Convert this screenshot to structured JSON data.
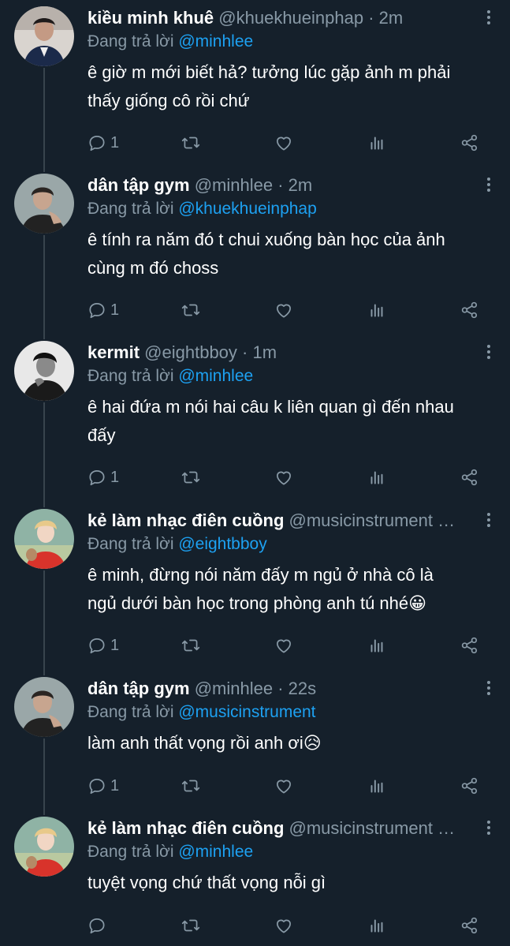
{
  "colors": {
    "background": "#15202b",
    "text": "#ffffff",
    "muted": "#8899a6",
    "link": "#1da1f2",
    "thread": "#38444d"
  },
  "replies_prefix": "Đang trả lời",
  "tweets": [
    {
      "name": "kiều minh khuê",
      "handle": "@khuekhueinphap",
      "sep": "·",
      "time": "2m",
      "reply_to": "@minhlee",
      "text": [
        "ê giờ m mới biết hả? tưởng lúc gặp ảnh m phải",
        "thấy giống cô rồi chứ"
      ],
      "reply_count": "1",
      "icons": [
        "comment-icon",
        "retweet-icon",
        "like-icon",
        "stats-icon",
        "share-icon"
      ]
    },
    {
      "name": "dân tập gym",
      "handle": "@minhlee",
      "sep": "·",
      "time": "2m",
      "reply_to": "@khuekhueinphap",
      "text": [
        "ê tính ra năm đó t chui xuống bàn học của ảnh",
        "cùng m đó choss"
      ],
      "reply_count": "1"
    },
    {
      "name": "kermit",
      "handle": "@eightbboy",
      "sep": "·",
      "time": "1m",
      "reply_to": "@minhlee",
      "text": [
        "ê hai đứa m nói hai câu k liên quan gì đến nhau",
        "đấy"
      ],
      "reply_count": "1"
    },
    {
      "name": "kẻ làm nhạc điên cuồng",
      "handle": "@musicinstrument …",
      "sep": "",
      "time": "",
      "reply_to": "@eightbboy",
      "text": [
        "ê minh, đừng nói năm đấy m ngủ ở nhà cô là",
        "ngủ dưới bàn học trong phòng anh tú nhé😀"
      ],
      "reply_count": "1"
    },
    {
      "name": "dân tập gym",
      "handle": "@minhlee",
      "sep": "·",
      "time": "22s",
      "reply_to": "@musicinstrument",
      "text": [
        "làm anh thất vọng rồi anh ơi😥"
      ],
      "reply_count": "1"
    },
    {
      "name": "kẻ làm nhạc điên cuồng",
      "handle": "@musicinstrument …",
      "sep": "",
      "time": "",
      "reply_to": "@minhlee",
      "text": [
        "tuyệt vọng chứ thất vọng nỗi gì"
      ],
      "reply_count": ""
    }
  ]
}
